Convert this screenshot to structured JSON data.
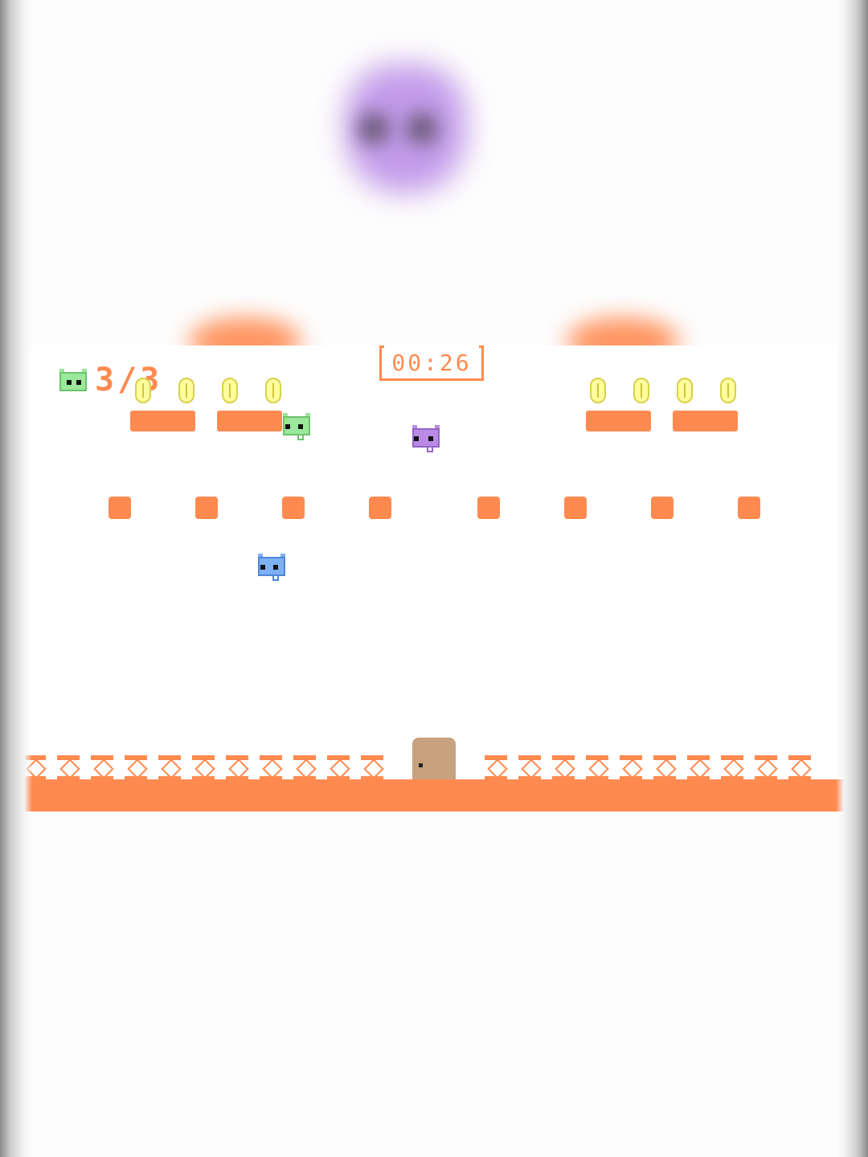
{
  "hud": {
    "players_saved": "3/3",
    "timer": "00:26",
    "player_icon": "green-cat-icon"
  },
  "colors": {
    "wall": "#ff8a50",
    "coin": "#fffd9c",
    "coin_border": "#d8d04a",
    "door": "#c8a27f",
    "cat_green": "#9be79b",
    "cat_purple": "#b98ae6",
    "cat_blue": "#7db0f5",
    "background": "#ffffff"
  },
  "players": [
    {
      "name": "green-cat",
      "color": "#9be79b"
    },
    {
      "name": "purple-cat",
      "color": "#b98ae6"
    },
    {
      "name": "blue-cat",
      "color": "#7db0f5"
    }
  ],
  "coins": {
    "left_group": 4,
    "right_group": 4
  }
}
